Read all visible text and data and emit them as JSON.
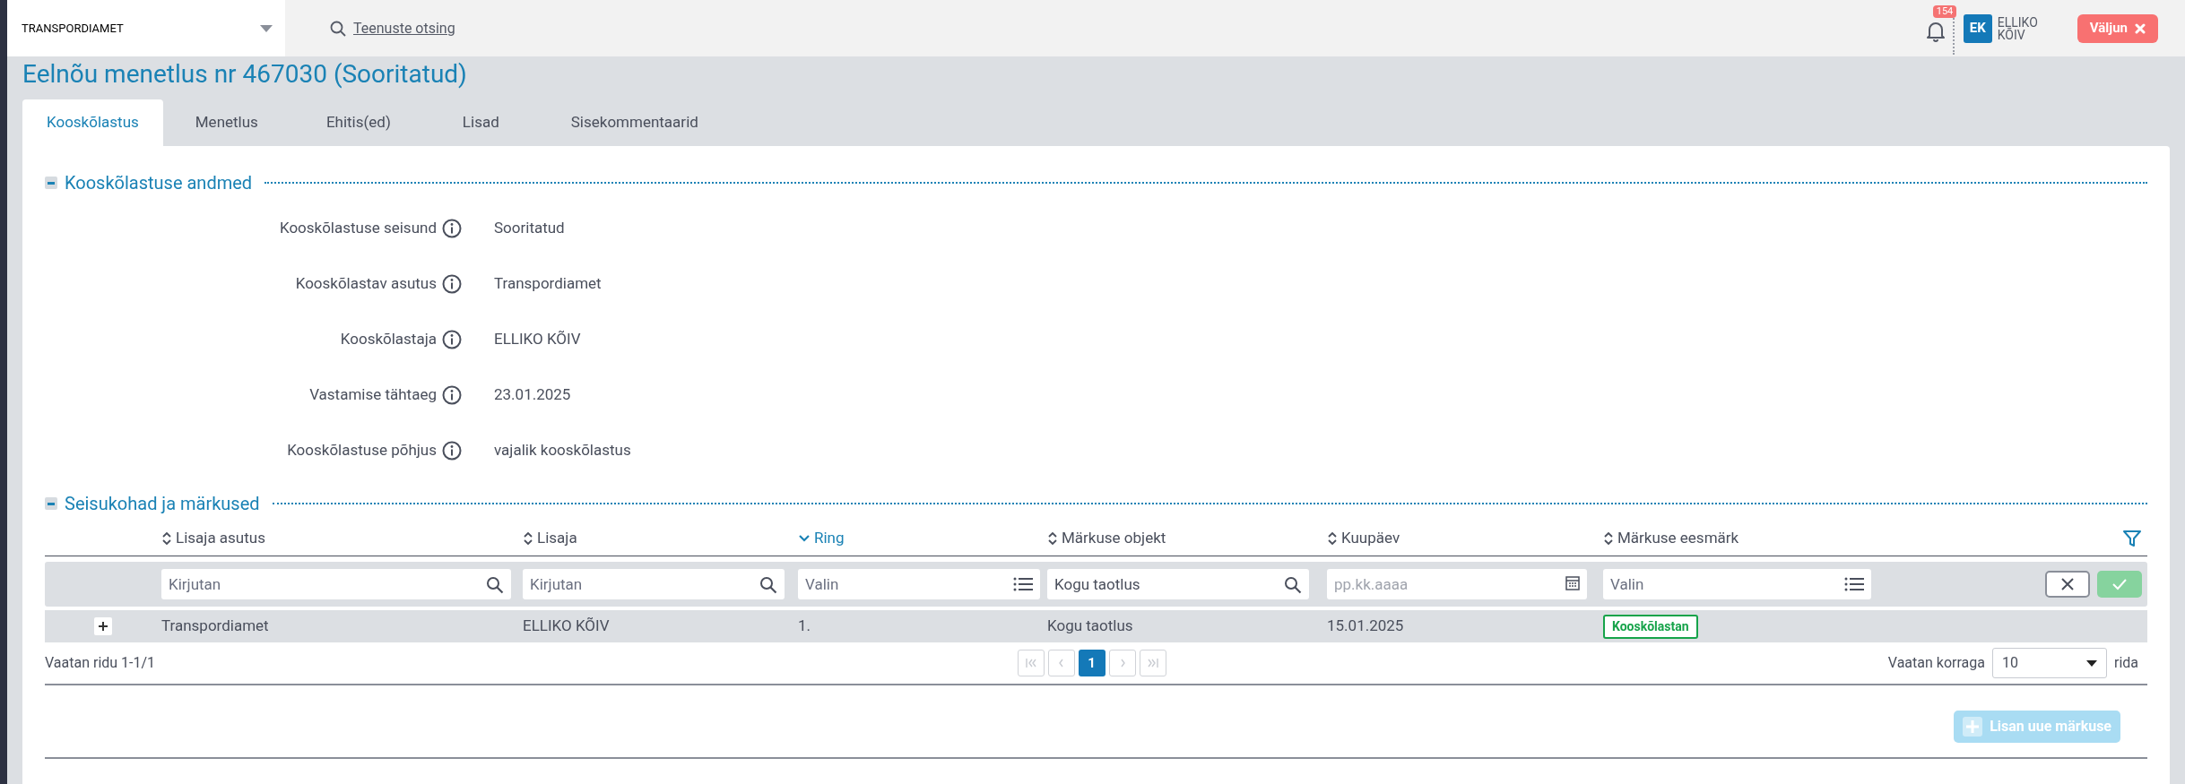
{
  "header": {
    "organization": "TRANSPORDIAMET",
    "search_link": "Teenuste otsing",
    "notification_count": "154",
    "user": {
      "initials": "EK",
      "first_name": "ELLIKO",
      "last_name": "KÕIV"
    },
    "logout_button": "Väljun"
  },
  "page_title": "Eelnõu menetlus nr 467030 (Sooritatud)",
  "tabs": [
    {
      "label": "Kooskõlastus",
      "selected": true
    },
    {
      "label": "Menetlus",
      "selected": false
    },
    {
      "label": "Ehitis(ed)",
      "selected": false
    },
    {
      "label": "Lisad",
      "selected": false
    },
    {
      "label": "Sisekommentaarid",
      "selected": false
    }
  ],
  "details_section": {
    "title": "Kooskõlastuse andmed",
    "expanded": true,
    "fields": [
      {
        "label": "Kooskõlastuse seisund",
        "value": "Sooritatud"
      },
      {
        "label": "Kooskõlastav asutus",
        "value": "Transpordiamet"
      },
      {
        "label": "Kooskõlastaja",
        "value": "ELLIKO KÕIV"
      },
      {
        "label": "Vastamise tähtaeg",
        "value": "23.01.2025"
      },
      {
        "label": "Kooskõlastuse põhjus",
        "value": "vajalik kooskõlastus"
      }
    ]
  },
  "remarks_section": {
    "title": "Seisukohad ja märkused",
    "expanded": true,
    "table": {
      "columns": [
        {
          "label": "Lisaja asutus",
          "sorted": false
        },
        {
          "label": "Lisaja",
          "sorted": false
        },
        {
          "label": "Ring",
          "sorted": true
        },
        {
          "label": "Märkuse objekt",
          "sorted": false
        },
        {
          "label": "Kuupäev",
          "sorted": false
        },
        {
          "label": "Märkuse eesmärk",
          "sorted": false
        }
      ],
      "filters": [
        {
          "kind": "text",
          "placeholder": "Kirjutan"
        },
        {
          "kind": "text",
          "placeholder": "Kirjutan"
        },
        {
          "kind": "select",
          "placeholder": "Valin"
        },
        {
          "kind": "text",
          "value": "Kogu taotlus"
        },
        {
          "kind": "date",
          "placeholder": "pp.kk.aaaa"
        },
        {
          "kind": "select",
          "placeholder": "Valin"
        }
      ],
      "rows": [
        {
          "expanded": false,
          "cells": [
            "Transpordiamet",
            "ELLIKO KÕIV",
            "1.",
            "Kogu taotlus",
            "15.01.2025"
          ],
          "purpose_tag": "Kooskõlastan"
        }
      ]
    },
    "row_count": "Vaatan ridu 1-1/1",
    "pagination": {
      "first_disabled": true,
      "prev_disabled": true,
      "pages": [
        {
          "label": "1",
          "selected": true
        }
      ],
      "next_disabled": true,
      "last_disabled": true
    },
    "page_size_label": "Vaatan korraga",
    "page_size": "10",
    "page_size_suffix": "rida",
    "add_button": {
      "label": "Lisan uue märkuse",
      "disabled": true
    }
  }
}
